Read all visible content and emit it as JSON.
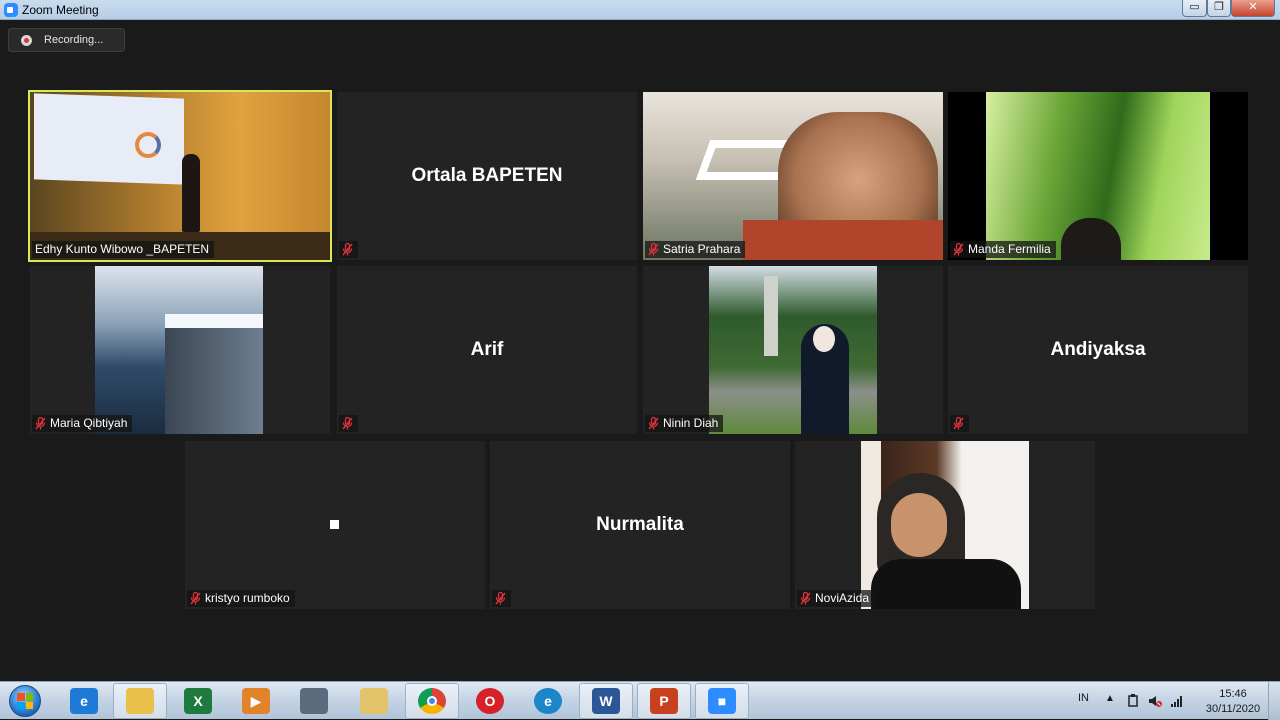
{
  "window": {
    "title": "Zoom Meeting",
    "min_label": "▭",
    "max_label": "❐",
    "close_label": "✕"
  },
  "recording": {
    "label": "Recording..."
  },
  "participants": [
    {
      "name": "Edhy Kunto Wibowo _BAPETEN",
      "display": "",
      "video": "slide",
      "muted": false,
      "active": true
    },
    {
      "name": "",
      "display": "Ortala BAPETEN",
      "video": "none",
      "muted": true,
      "active": false
    },
    {
      "name": "Satria Prahara",
      "display": "",
      "video": "room",
      "muted": true,
      "active": false
    },
    {
      "name": "Manda Fermilia",
      "display": "",
      "video": "grass",
      "muted": true,
      "active": false
    },
    {
      "name": "Maria Qibtiyah",
      "display": "",
      "video": "cliff",
      "muted": true,
      "active": false
    },
    {
      "name": "",
      "display": "Arif",
      "video": "none",
      "muted": true,
      "active": false
    },
    {
      "name": "Ninin Diah",
      "display": "",
      "video": "park",
      "muted": true,
      "active": false
    },
    {
      "name": "",
      "display": "Andiyaksa",
      "video": "none",
      "muted": true,
      "active": false
    },
    {
      "name": "kristyo rumboko",
      "display": "",
      "video": "blank",
      "muted": true,
      "active": false
    },
    {
      "name": "",
      "display": "Nurmalita",
      "video": "none",
      "muted": true,
      "active": false
    },
    {
      "name": "NoviAzida",
      "display": "",
      "video": "portrait",
      "muted": true,
      "active": false
    }
  ],
  "taskbar": {
    "apps": [
      {
        "name": "Internet Explorer",
        "icon": "ie-icon",
        "color": "#1d7ad6",
        "glyph": "e",
        "open": false
      },
      {
        "name": "File Explorer",
        "icon": "folder-icon",
        "color": "#e8c04a",
        "glyph": "",
        "open": true
      },
      {
        "name": "Excel",
        "icon": "excel-icon",
        "color": "#1f7a3f",
        "glyph": "X",
        "open": false
      },
      {
        "name": "Media Player",
        "icon": "media-player-icon",
        "color": "#e0832a",
        "glyph": "▶",
        "open": false
      },
      {
        "name": "Network",
        "icon": "network-icon",
        "color": "#5a6b7d",
        "glyph": "",
        "open": false
      },
      {
        "name": "Folder",
        "icon": "folder-icon",
        "color": "#e2c36a",
        "glyph": "",
        "open": false
      },
      {
        "name": "Chrome",
        "icon": "chrome-icon",
        "color": "#d93a2f",
        "glyph": "",
        "open": true
      },
      {
        "name": "Opera",
        "icon": "opera-icon",
        "color": "#d6202a",
        "glyph": "O",
        "open": false
      },
      {
        "name": "Edge",
        "icon": "edge-icon",
        "color": "#1b86c9",
        "glyph": "e",
        "open": false
      },
      {
        "name": "Word",
        "icon": "word-icon",
        "color": "#2b5797",
        "glyph": "W",
        "open": true
      },
      {
        "name": "PowerPoint",
        "icon": "powerpoint-icon",
        "color": "#c8401f",
        "glyph": "P",
        "open": true
      },
      {
        "name": "Zoom",
        "icon": "zoom-icon",
        "color": "#2d8cff",
        "glyph": "■",
        "open": true
      }
    ],
    "tray": {
      "lang": "IN",
      "arrow": "▲",
      "time": "15:46",
      "date": "30/11/2020"
    }
  },
  "colors": {
    "active_outline": "#d9e85b",
    "muted_red": "#e0323a",
    "tile_bg": "#232323",
    "meeting_bg": "#1a1a1a"
  }
}
